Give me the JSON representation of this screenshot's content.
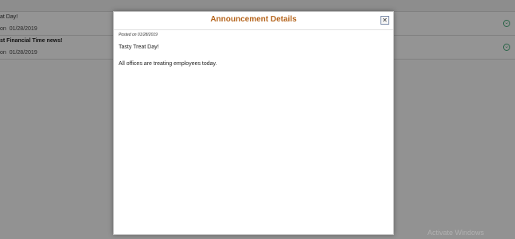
{
  "background_list": {
    "items": [
      {
        "title": "at Day!",
        "date_label": "on",
        "date": "01/28/2019"
      },
      {
        "title": "st Financial Time news!",
        "date_label": "on",
        "date": "01/28/2019"
      }
    ],
    "expand_icon_glyph": "⌄"
  },
  "modal": {
    "title": "Announcement Details",
    "close_glyph": "✕",
    "posted_text": "Posted on 01/28/2019",
    "announcement_title": "Tasty Treat Day!",
    "announcement_body": "All offices are treating employees today."
  },
  "watermark": "Activate Windows",
  "colors": {
    "modal_title": "#b5651d",
    "expand_icon": "#4caf7e"
  }
}
